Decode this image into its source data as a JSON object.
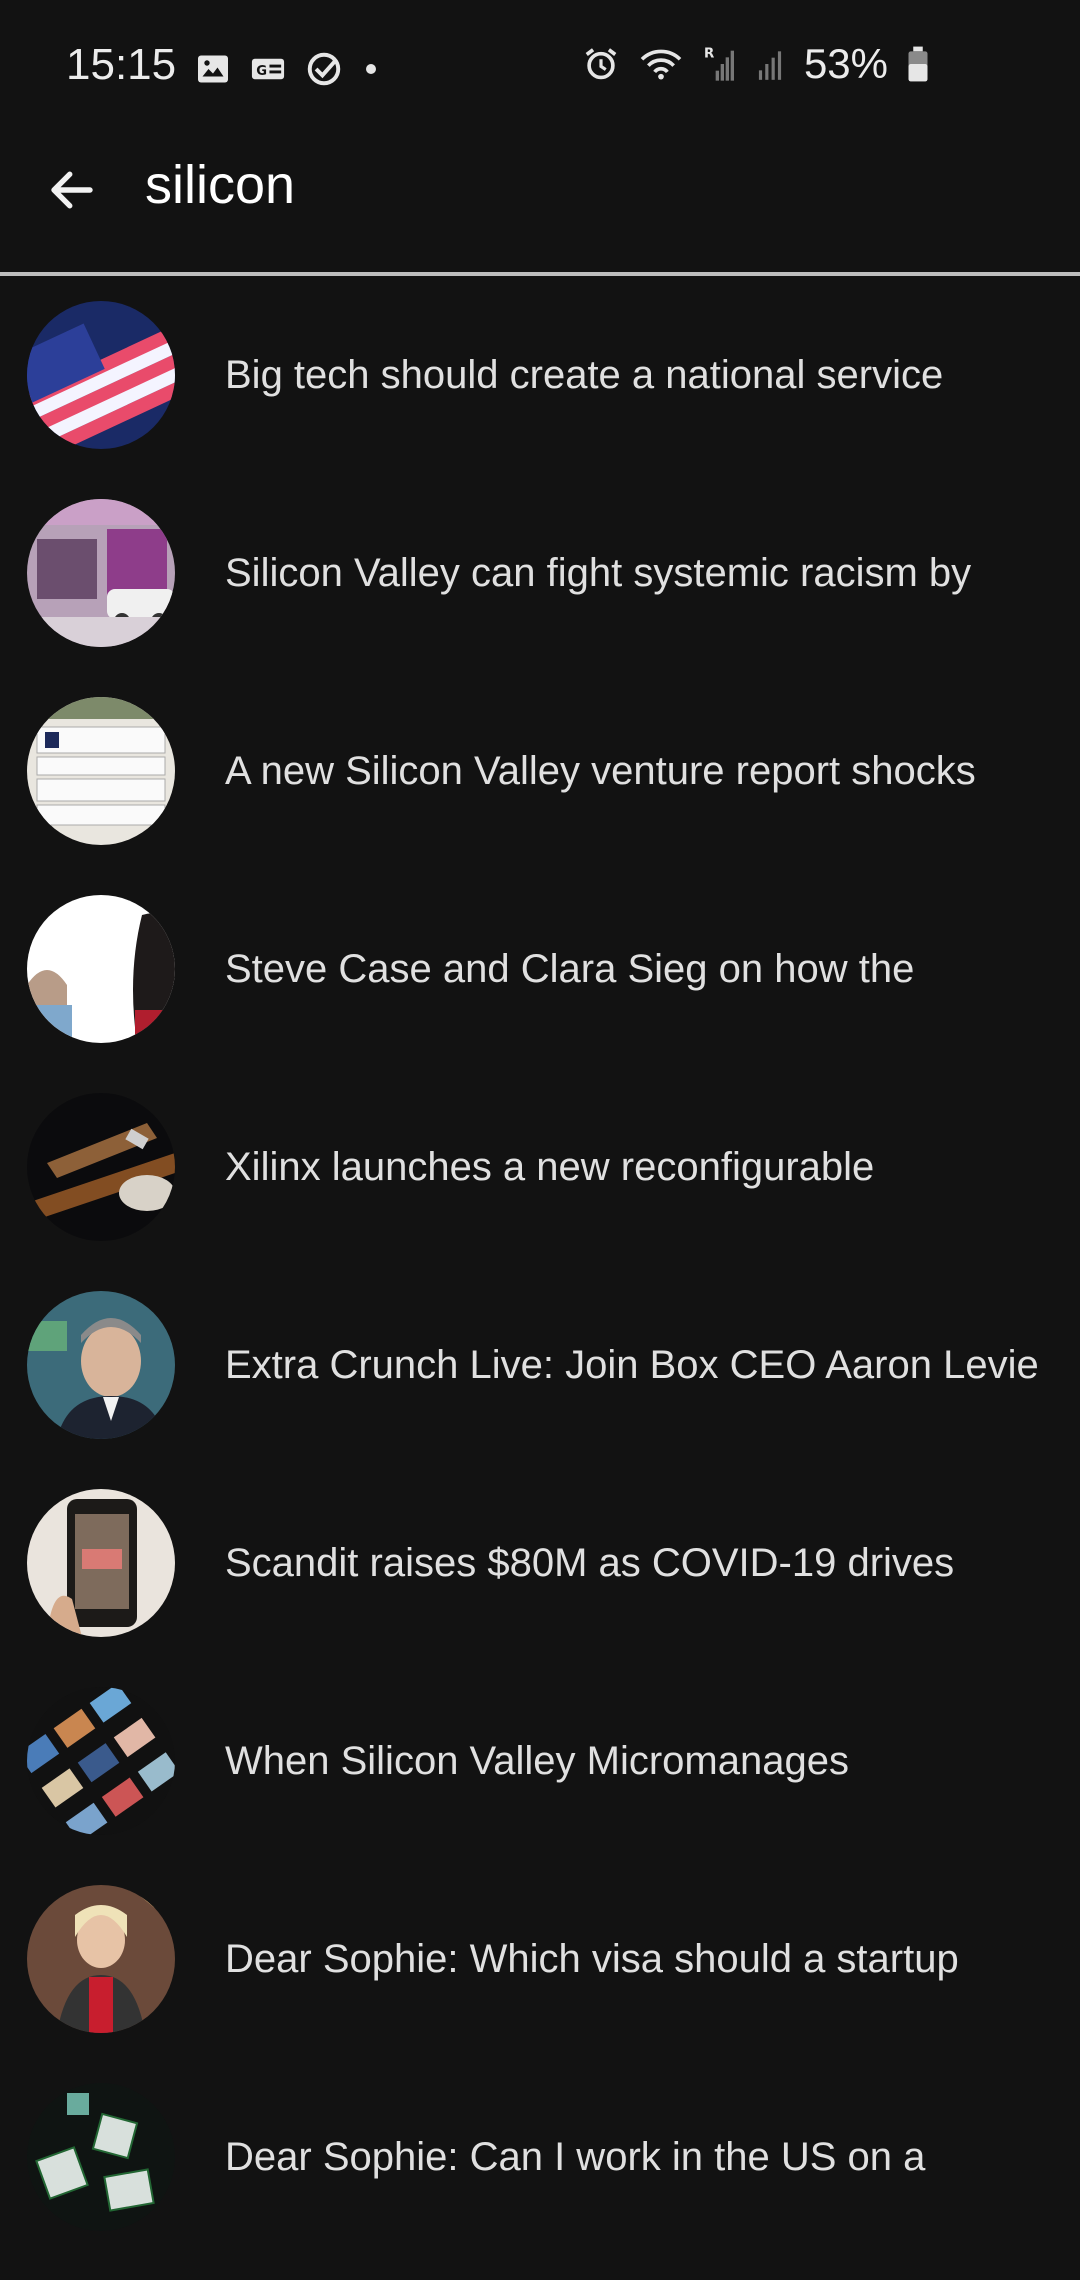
{
  "status_bar": {
    "time": "15:15",
    "battery_percent": "53%",
    "left_icons": [
      "gallery-icon",
      "news-icon",
      "check-circle-icon",
      "dot-icon"
    ],
    "right_icons": [
      "alarm-icon",
      "wifi-icon",
      "signal-roaming-icon",
      "signal-icon",
      "battery-icon"
    ]
  },
  "search": {
    "query": "silicon",
    "back_icon": "arrow-left-icon"
  },
  "results": [
    {
      "title": "Big tech should create a national service",
      "thumb": "flag"
    },
    {
      "title": "Silicon Valley can fight systemic racism by",
      "thumb": "mural"
    },
    {
      "title": "A new Silicon Valley venture report shocks",
      "thumb": "sign"
    },
    {
      "title": "Steve Case and Clara Sieg on how the",
      "thumb": "portraits"
    },
    {
      "title": "Xilinx launches a new reconfigurable",
      "thumb": "satellite"
    },
    {
      "title": "Extra Crunch Live: Join Box CEO Aaron Levie",
      "thumb": "speaker"
    },
    {
      "title": "Scandit raises $80M as COVID-19 drives",
      "thumb": "phone"
    },
    {
      "title": "When Silicon Valley Micromanages",
      "thumb": "tiles"
    },
    {
      "title": "Dear Sophie: Which visa should a startup",
      "thumb": "woman"
    },
    {
      "title": "Dear Sophie: Can I work in the US on a",
      "thumb": "cubes"
    }
  ]
}
